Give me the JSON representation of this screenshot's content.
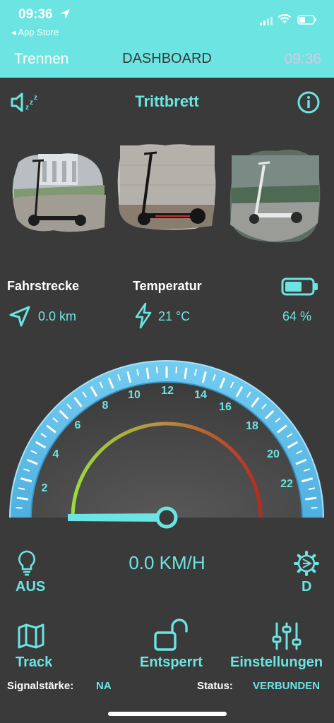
{
  "status_bar": {
    "time": "09:36",
    "back_app": "◂ App Store"
  },
  "nav": {
    "left": "Trennen",
    "title": "DASHBOARD",
    "right": "09:36"
  },
  "profile": {
    "title": "Trittbrett"
  },
  "stats": {
    "distance_label": "Fahrstrecke",
    "distance_value": "0.0 km",
    "temperature_label": "Temperatur",
    "temperature_value": "21 °C",
    "battery_value": "64 %",
    "battery_level": 0.64
  },
  "gauge": {
    "ticks": [
      "2",
      "4",
      "6",
      "8",
      "10",
      "12",
      "14",
      "16",
      "18",
      "20",
      "22"
    ],
    "speed": 0.0,
    "speed_text": "0.0 KM/H"
  },
  "controls": {
    "light": "AUS",
    "gear": "D"
  },
  "bottom": {
    "track": "Track",
    "lock": "Entsperrt",
    "settings": "Einstellungen"
  },
  "footer": {
    "signal_label": "Signalstärke:",
    "signal_value": "NA",
    "status_label": "Status:",
    "status_value": "VERBUNDEN"
  },
  "colors": {
    "accent": "#6be4e2",
    "background": "#3a3a3a",
    "header": "#6be4e2"
  }
}
